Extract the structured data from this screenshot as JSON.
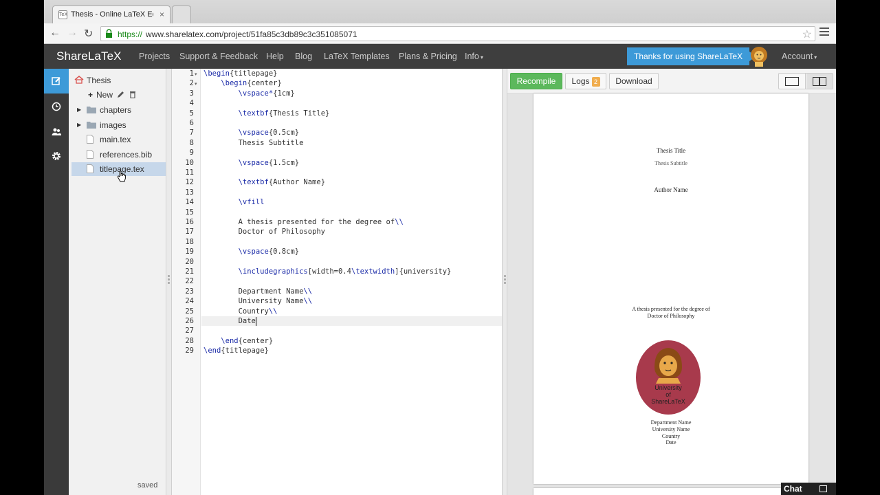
{
  "browser": {
    "tab_title": "Thesis - Online LaTeX Edi",
    "tab_favicon": "TeX",
    "url_scheme": "https://",
    "url_rest": "www.sharelatex.com/project/51fa85c3db89c3c351085071"
  },
  "header": {
    "brand": "ShareLaTeX",
    "nav": [
      "Projects",
      "Support & Feedback",
      "Help",
      "Blog",
      "LaTeX Templates",
      "Plans & Pricing",
      "Info"
    ],
    "thanks": "Thanks for using ShareLaTeX",
    "account": "Account"
  },
  "filetree": {
    "project": "Thesis",
    "new_label": "New",
    "items": [
      {
        "label": "chapters",
        "type": "folder"
      },
      {
        "label": "images",
        "type": "folder"
      },
      {
        "label": "main.tex",
        "type": "file"
      },
      {
        "label": "references.bib",
        "type": "file"
      },
      {
        "label": "titlepage.tex",
        "type": "file",
        "selected": true
      }
    ],
    "status": "saved"
  },
  "editor": {
    "active_line": 26,
    "lines": [
      "\\begin{titlepage}",
      "    \\begin{center}",
      "        \\vspace*{1cm}",
      "",
      "        \\textbf{Thesis Title}",
      "",
      "        \\vspace{0.5cm}",
      "        Thesis Subtitle",
      "",
      "        \\vspace{1.5cm}",
      "",
      "        \\textbf{Author Name}",
      "",
      "        \\vfill",
      "",
      "        A thesis presented for the degree of\\\\",
      "        Doctor of Philosophy",
      "",
      "        \\vspace{0.8cm}",
      "",
      "        \\includegraphics[width=0.4\\textwidth]{university}",
      "",
      "        Department Name\\\\",
      "        University Name\\\\",
      "        Country\\\\",
      "        Date",
      "",
      "    \\end{center}",
      "\\end{titlepage}"
    ]
  },
  "pdf": {
    "recompile": "Recompile",
    "logs": "Logs",
    "logs_count": "2",
    "download": "Download",
    "page": {
      "title": "Thesis Title",
      "subtitle": "Thesis Subtitle",
      "author": "Author Name",
      "degree_line1": "A thesis presented for the degree of",
      "degree_line2": "Doctor of Philosophy",
      "seal_lines": [
        "University",
        "of",
        "ShareLaTeX"
      ],
      "department": "Department Name",
      "university": "University Name",
      "country": "Country",
      "date": "Date"
    }
  },
  "chat": {
    "label": "Chat"
  },
  "colors": {
    "accent": "#3d9ad8",
    "recompile": "#5cb85c",
    "seal": "#a83a4c",
    "keyword": "#1c2ca8"
  }
}
